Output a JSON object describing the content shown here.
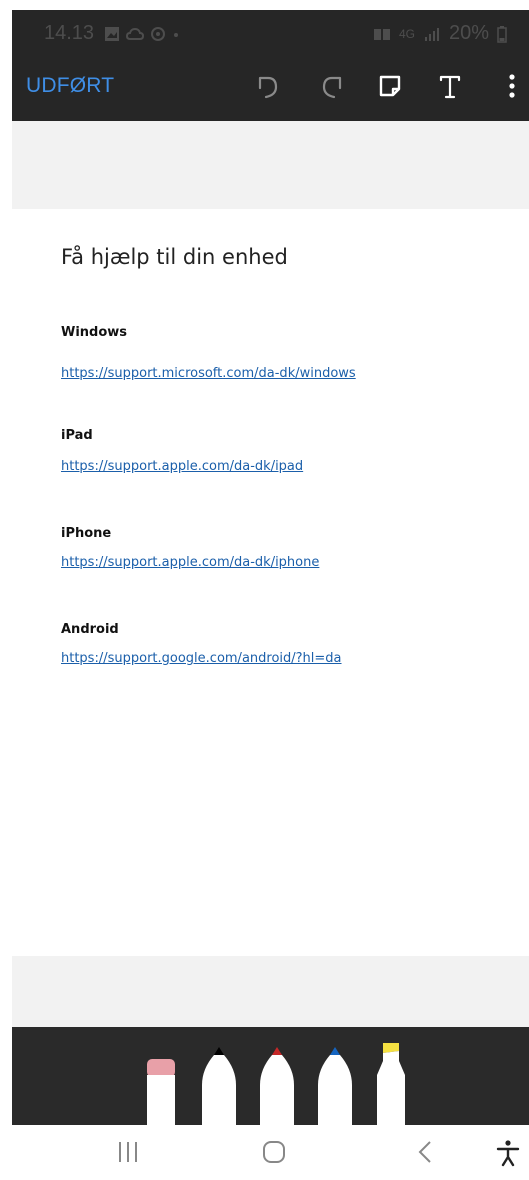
{
  "status_bar": {
    "time": "14.13",
    "notification_icons": [
      "image-icon",
      "cloud-icon",
      "circle-icon",
      "dot-icon"
    ],
    "network_text": "4G",
    "battery": "20%"
  },
  "toolbar": {
    "done_label": "UDFØRT",
    "icons": [
      "undo-icon",
      "redo-icon",
      "sticky-note-icon",
      "text-icon",
      "more-icon"
    ]
  },
  "document": {
    "heading": "Få hjælp til din enhed",
    "sections": [
      {
        "title": "Windows",
        "link": "https://support.microsoft.com/da-dk/windows"
      },
      {
        "title": "iPad",
        "link": "https://support.apple.com/da-dk/ipad"
      },
      {
        "title": "iPhone",
        "link": "https://support.apple.com/da-dk/iphone"
      },
      {
        "title": "Android",
        "link": "https://support.google.com/android/?hl=da"
      }
    ]
  },
  "pens": [
    {
      "name": "eraser",
      "color": "#e8a0a8"
    },
    {
      "name": "pen-black",
      "color": "#000000"
    },
    {
      "name": "pen-red",
      "color": "#c62828"
    },
    {
      "name": "pen-blue",
      "color": "#1565c0"
    },
    {
      "name": "highlighter-yellow",
      "color": "#f5e142"
    }
  ],
  "colors": {
    "bar_background": "#262626",
    "accent": "#3f8ee6",
    "link": "#1b5faa"
  }
}
